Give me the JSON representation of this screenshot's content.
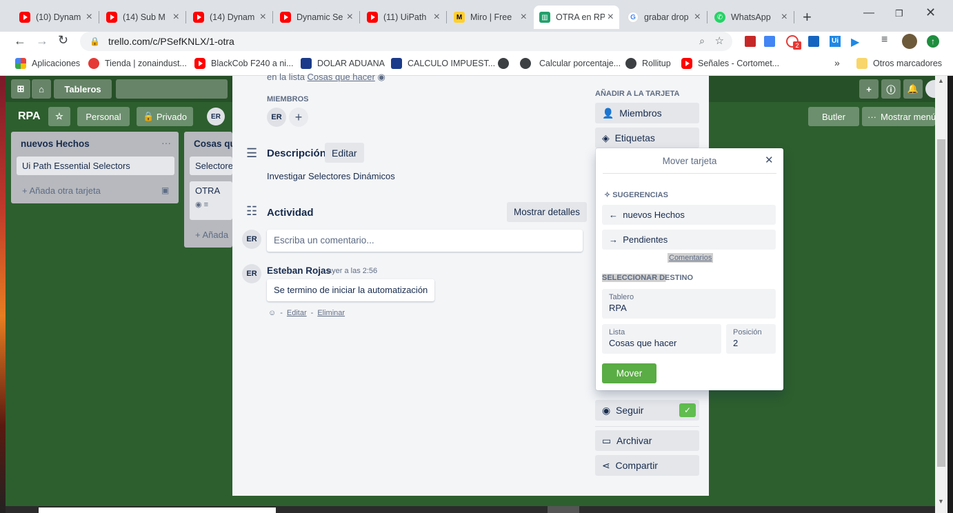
{
  "browser": {
    "tabs": [
      {
        "title": "(10) Dynam",
        "icon": "youtube-icon"
      },
      {
        "title": "(14) Sub M",
        "icon": "youtube-icon"
      },
      {
        "title": "(14) Dynam",
        "icon": "youtube-icon"
      },
      {
        "title": "Dynamic Se",
        "icon": "youtube-icon"
      },
      {
        "title": "(11) UiPath",
        "icon": "youtube-icon"
      },
      {
        "title": "Miro | Free",
        "icon": "miro-icon"
      },
      {
        "title": "OTRA en RP",
        "icon": "trello-icon"
      },
      {
        "title": "grabar drop",
        "icon": "google-icon"
      },
      {
        "title": "WhatsApp",
        "icon": "whatsapp-icon"
      }
    ],
    "url": "trello.com/c/PSefKNLX/1-otra",
    "bookmarks": [
      "Aplicaciones",
      "Tienda | zonaindust...",
      "BlackCob F240 a ni...",
      "DOLAR ADUANA",
      "CALCULO IMPUEST...",
      "Calcular porcentaje...",
      "Rollitup",
      "Señales - Cortomet...",
      "Otros marcadores"
    ],
    "ext_badge": "2"
  },
  "board": {
    "nav_boards": "Tableros",
    "name": "RPA",
    "team": "Personal",
    "visibility": "Privado",
    "member_initials": "ER",
    "butler": "Butler",
    "menu": "Mostrar menú",
    "lists": [
      {
        "title": "nuevos Hechos",
        "cards": [
          "Ui Path Essential Selectors"
        ],
        "add": "Añada otra tarjeta"
      },
      {
        "title": "Cosas que",
        "cards": [
          "Selectores",
          "OTRA"
        ],
        "add": "Añada"
      }
    ]
  },
  "card_modal": {
    "in_list_prefix": "en la lista",
    "in_list_link": "Cosas que hacer",
    "members_label": "MIEMBROS",
    "member_initials": "ER",
    "description_label": "Descripción",
    "edit_label": "Editar",
    "description": "Investigar Selectores Dinámicos",
    "activity_label": "Actividad",
    "show_details": "Mostrar detalles",
    "comment_placeholder": "Escriba un comentario...",
    "comment": {
      "author": "Esteban Rojas",
      "time": "ayer a las 2:56",
      "text": "Se termino de iniciar la automatización",
      "edit": "Editar",
      "delete": "Eliminar",
      "sep": "-"
    },
    "sidebar": {
      "add_to_card": "AÑADIR A LA TARJETA",
      "members": "Miembros",
      "labels": "Etiquetas",
      "follow": "Seguir",
      "archive": "Archivar",
      "share": "Compartir"
    }
  },
  "move_popover": {
    "title": "Mover tarjeta",
    "suggestions_label": "SUGERENCIAS",
    "suggestion_1": "nuevos Hechos",
    "suggestion_2": "Pendientes",
    "feedback": "Comentarios",
    "select_dest": "SELECCIONAR DESTINO",
    "board_label": "Tablero",
    "board_value": "RPA",
    "list_label": "Lista",
    "list_value": "Cosas que hacer",
    "position_label": "Posición",
    "position_value": "2",
    "move_button": "Mover"
  }
}
